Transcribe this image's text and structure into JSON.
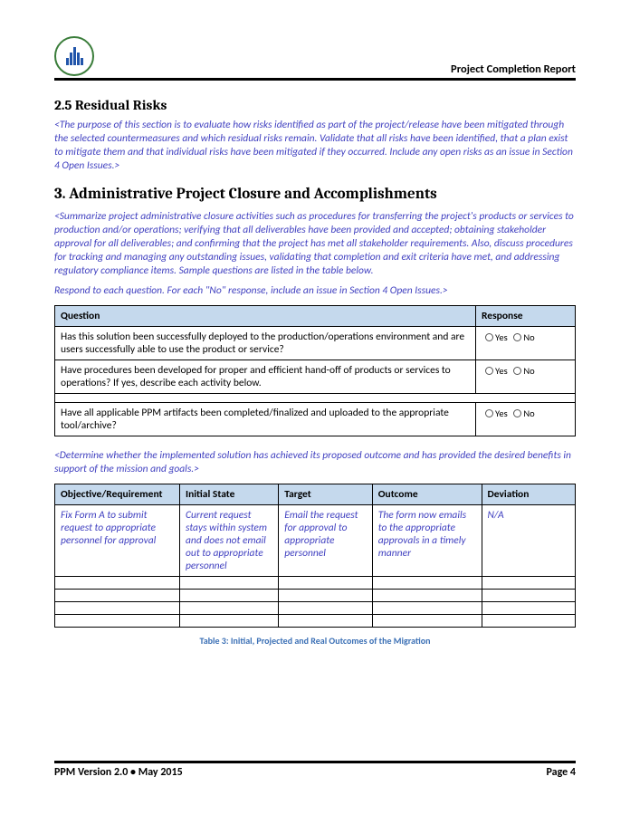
{
  "header": {
    "title": "Project Completion Report"
  },
  "section25": {
    "heading": "2.5 Residual Risks",
    "instruction": "<The purpose of this section is to evaluate how risks identified as part of the project/release have been mitigated through the selected countermeasures and which residual risks remain. Validate that all risks have been identified, that a plan exist to mitigate them and that individual risks have been mitigated if they occurred. Include any open risks as an issue in Section 4 Open Issues.>"
  },
  "section3": {
    "heading": "3.  Administrative Project Closure and Accomplishments",
    "instruction": "<Summarize project administrative closure activities such as procedures for transferring the project's products or services to production and/or operations; verifying that all deliverables have been provided and accepted; obtaining stakeholder approval for all deliverables; and confirming that the project has met all stakeholder requirements. Also, discuss procedures for tracking and managing any outstanding issues, validating that completion and exit criteria have met, and addressing regulatory compliance items. Sample questions are listed in the table below.",
    "instruction2": "Respond to each question. For each \"No\" response, include an issue in Section 4 Open Issues.>",
    "qtable": {
      "header_q": "Question",
      "header_r": "Response",
      "yes": "Yes",
      "no": "No",
      "q1": "Has this solution been successfully deployed to the production/operations environment and are users successfully able to use the product or service?",
      "q2": "Have procedures been developed for proper and efficient hand-off of products or services to operations? If yes, describe each activity below.",
      "q3": "Have all applicable PPM artifacts been completed/finalized and uploaded to the appropriate tool/archive?"
    },
    "instruction3": "<Determine whether the implemented solution has achieved its proposed outcome and has provided the desired benefits in support of the mission and goals.>",
    "otable": {
      "h1": "Objective/Requirement",
      "h2": "Initial State",
      "h3": "Target",
      "h4": "Outcome",
      "h5": "Deviation",
      "r1c1": "Fix Form A to submit request to appropriate personnel for approval",
      "r1c2": "Current request stays within system and does not email out to appropriate personnel",
      "r1c3": "Email the request for approval to appropriate personnel",
      "r1c4": "The form now emails to the appropriate approvals in a timely manner",
      "r1c5": "N/A"
    },
    "caption": "Table 3: Initial, Projected and Real Outcomes of the Migration"
  },
  "footer": {
    "left": "PPM Version 2.0 • May 2015",
    "right": "Page 4"
  }
}
